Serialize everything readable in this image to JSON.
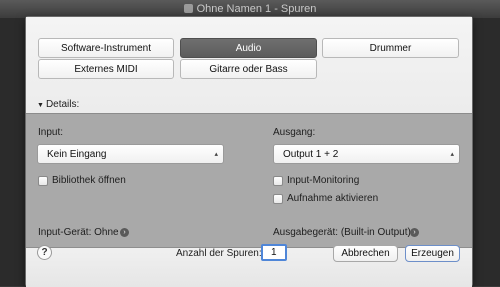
{
  "window": {
    "title": "Ohne Namen 1 - Spuren"
  },
  "track_types": {
    "software_instrument": "Software-Instrument",
    "audio": "Audio",
    "drummer": "Drummer",
    "external_midi": "Externes MIDI",
    "guitar_bass": "Gitarre oder Bass"
  },
  "details": {
    "label": "Details:"
  },
  "input": {
    "label": "Input:",
    "value": "Kein Eingang",
    "library_label": "Bibliothek öffnen",
    "device_label": "Input-Gerät: Ohne"
  },
  "output": {
    "label": "Ausgang:",
    "value": "Output 1 + 2",
    "monitoring_label": "Input-Monitoring",
    "record_enable_label": "Aufnahme aktivieren",
    "device_label": "Ausgabegerät: (Built-in Output)"
  },
  "footer": {
    "help": "?",
    "track_count_label": "Anzahl der Spuren:",
    "track_count": "1",
    "cancel": "Abbrechen",
    "create": "Erzeugen"
  }
}
